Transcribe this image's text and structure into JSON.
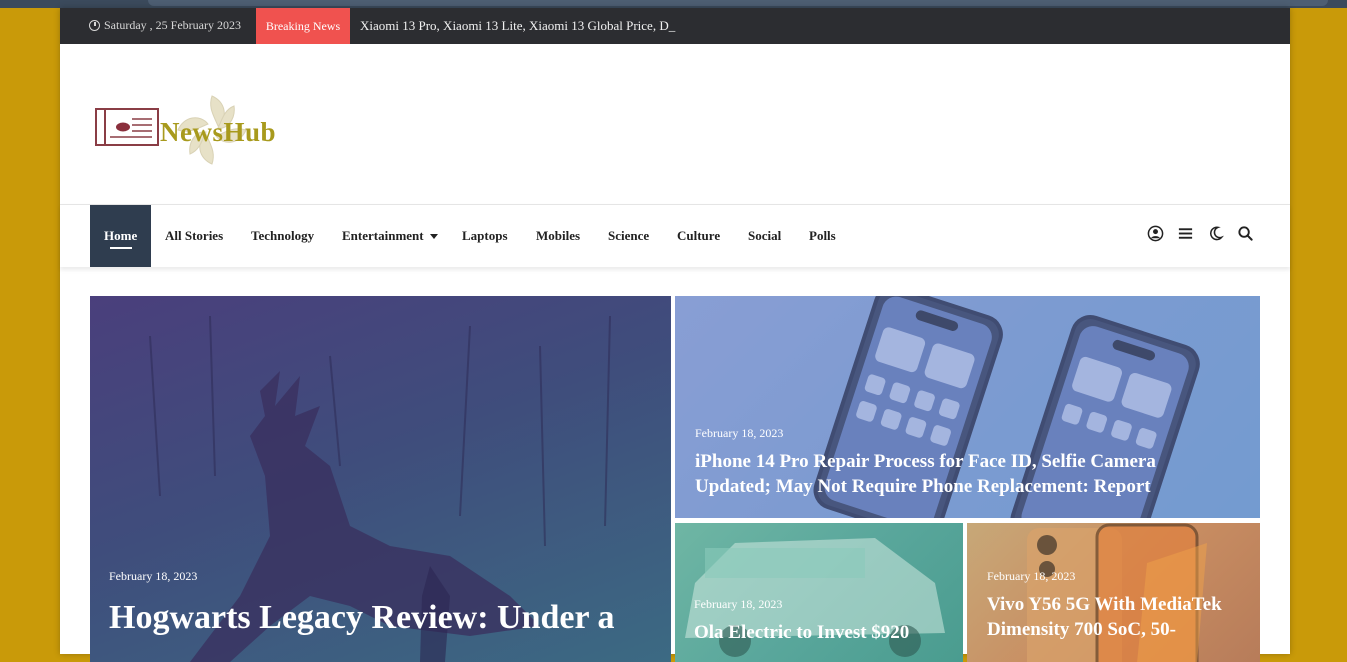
{
  "topbar": {
    "date": "Saturday , 25 February 2023",
    "breaking_label": "Breaking News",
    "ticker_text": "Xiaomi 13 Pro, Xiaomi 13 Lite, Xiaomi 13 Global Price, D_"
  },
  "header": {
    "logo_text": "NewsHub"
  },
  "nav": {
    "items": [
      {
        "label": "Home"
      },
      {
        "label": "All Stories"
      },
      {
        "label": "Technology"
      },
      {
        "label": "Entertainment"
      },
      {
        "label": "Laptops"
      },
      {
        "label": "Mobiles"
      },
      {
        "label": "Science"
      },
      {
        "label": "Culture"
      },
      {
        "label": "Social"
      },
      {
        "label": "Polls"
      }
    ],
    "icons": [
      "user-icon",
      "menu-icon",
      "moon-icon",
      "search-icon"
    ]
  },
  "featured": [
    {
      "date": "February 18, 2023",
      "title": "Hogwarts Legacy Review: Under a"
    },
    {
      "date": "February 18, 2023",
      "title": "iPhone 14 Pro Repair Process for Face ID, Selfie Camera Updated; May Not Require Phone Replacement: Report"
    },
    {
      "date": "February 18, 2023",
      "title": "Ola Electric to Invest $920"
    },
    {
      "date": "February 18, 2023",
      "title": "Vivo Y56 5G With MediaTek Dimensity 700 SoC, 50-"
    }
  ],
  "colors": {
    "page_background": "#c99a09",
    "topbar": "#2c2d31",
    "breaking": "#f0524f",
    "nav_active": "#2f3d4f",
    "logo_text": "#a89a1d"
  }
}
